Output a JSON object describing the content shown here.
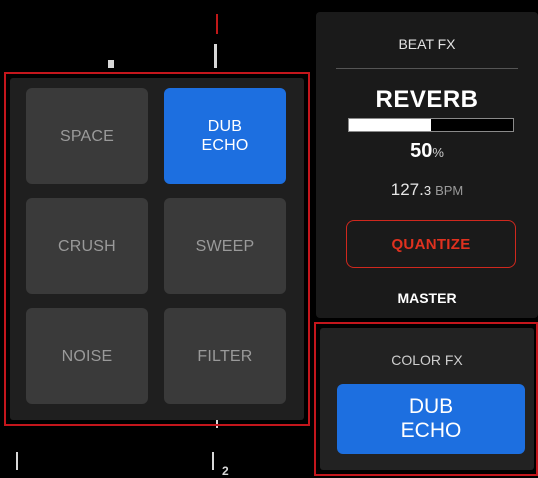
{
  "colors": {
    "accent_blue": "#1d6fe0",
    "highlight_red": "#c4161c",
    "quantize_red": "#e0311f",
    "pad_bg": "#3a3a3a"
  },
  "deck_marker": {
    "number": "2"
  },
  "fx_pads": [
    {
      "label": "SPACE",
      "active": false
    },
    {
      "label": "DUB\nECHO",
      "active": true
    },
    {
      "label": "CRUSH",
      "active": false
    },
    {
      "label": "SWEEP",
      "active": false
    },
    {
      "label": "NOISE",
      "active": false
    },
    {
      "label": "FILTER",
      "active": false
    }
  ],
  "beat_fx": {
    "title": "BEAT FX",
    "effect": "REVERB",
    "level_percent": 50,
    "level_value": "50",
    "level_unit": "%",
    "bpm_int": "127.",
    "bpm_dec": "3",
    "bpm_unit": "BPM",
    "quantize_label": "QUANTIZE",
    "channel": "MASTER"
  },
  "color_fx": {
    "title": "COLOR FX",
    "effect": "DUB\nECHO"
  }
}
